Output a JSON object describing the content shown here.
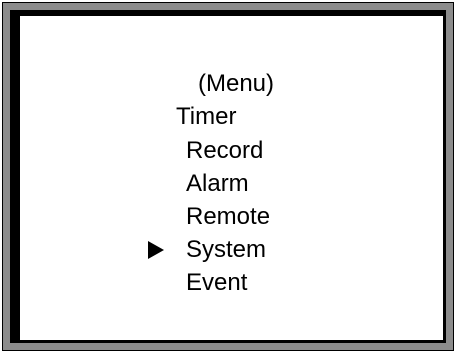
{
  "menu": {
    "title": "(Menu)",
    "items": [
      {
        "label": "Timer"
      },
      {
        "label": "Record"
      },
      {
        "label": "Alarm"
      },
      {
        "label": "Remote"
      },
      {
        "label": "System"
      },
      {
        "label": "Event"
      }
    ],
    "selected_label": "System",
    "cursor_icon": "right-pointing-triangle"
  },
  "colors": {
    "frame_gray": "#8c8c8c",
    "frame_black": "#000000",
    "screen_bg": "#ffffff",
    "text": "#000000"
  }
}
